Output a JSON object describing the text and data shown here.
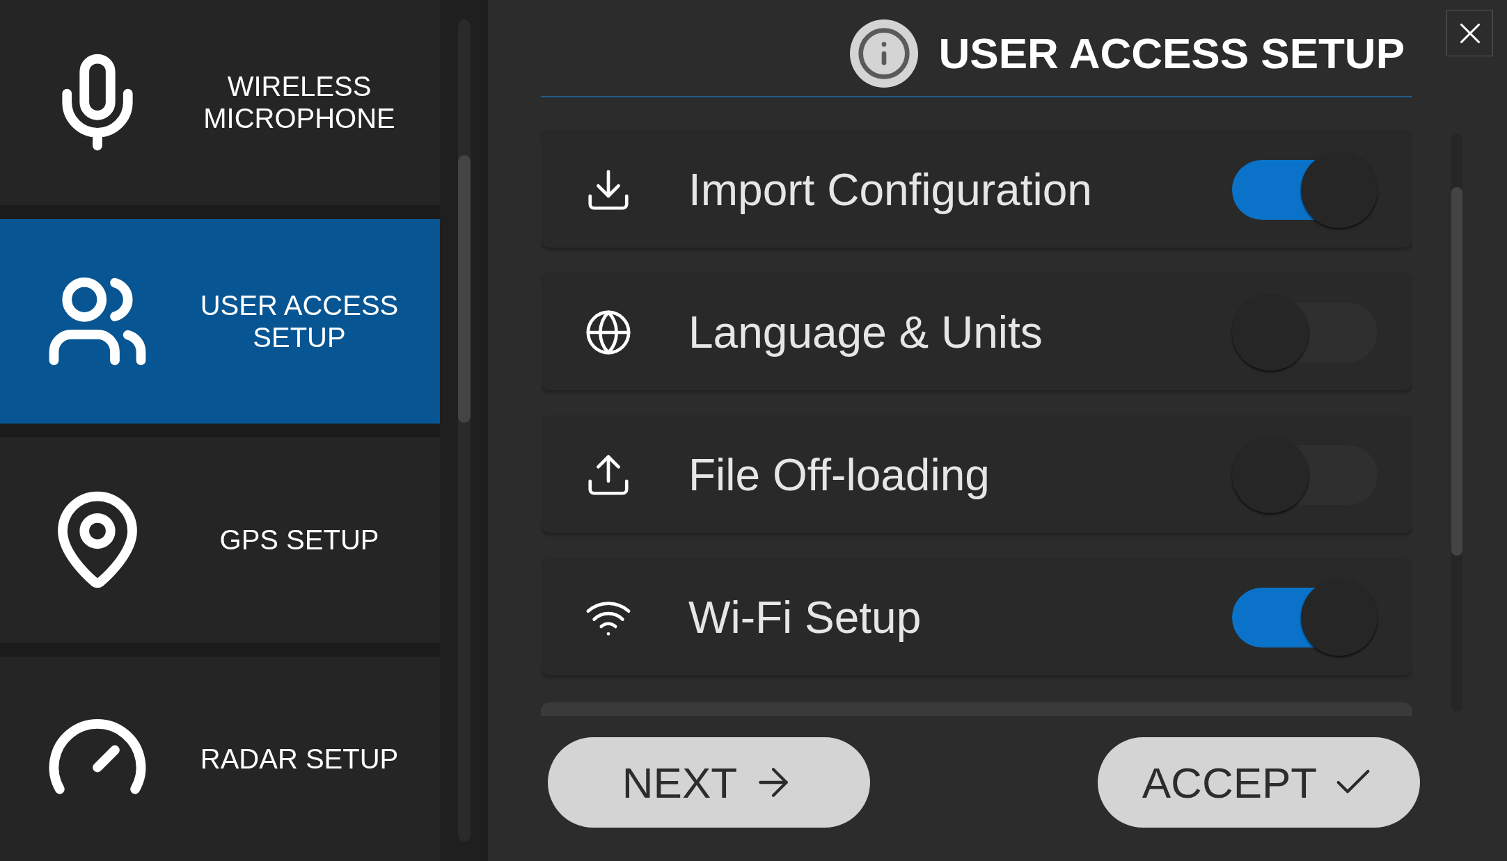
{
  "sidebar": {
    "items": [
      {
        "label": "WIRELESS MICROPHONE",
        "selected": false
      },
      {
        "label": "USER ACCESS SETUP",
        "selected": true
      },
      {
        "label": "GPS SETUP",
        "selected": false
      },
      {
        "label": "RADAR SETUP",
        "selected": false
      }
    ]
  },
  "panel": {
    "title": "USER ACCESS SETUP",
    "settings": [
      {
        "label": "Import Configuration",
        "on": true
      },
      {
        "label": "Language & Units",
        "on": false
      },
      {
        "label": "File Off-loading",
        "on": false
      },
      {
        "label": "Wi-Fi Setup",
        "on": true
      }
    ],
    "buttons": [
      {
        "label": "NEXT",
        "kind": "next"
      },
      {
        "label": "ACCEPT",
        "kind": "accept"
      }
    ]
  }
}
